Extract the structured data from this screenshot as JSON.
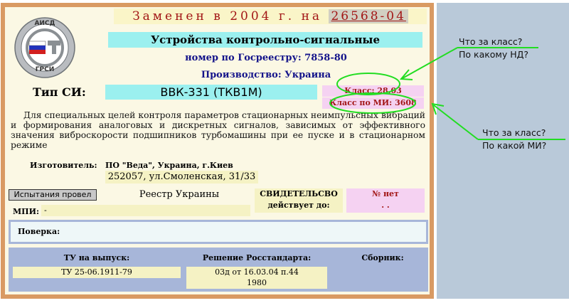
{
  "header": {
    "replaced_prefix": "Заменен в 2004 г. на",
    "replaced_number": "26568-04",
    "title": "Устройства контрольно-сигнальные",
    "registry_number": "номер по Госреестру: 7858-80",
    "production": "Производство: Украина"
  },
  "logo": {
    "top_text": "АИСД",
    "bottom_text": "ГРСИ"
  },
  "instrument": {
    "type_label": "Тип СИ:",
    "type_value": "ВВК-331 (ТКВ1М)",
    "class_nd": "Класс: 28.03",
    "class_mi": "Класс по МИ: 3608"
  },
  "description": "Для специальных целей контроля параметров стационарных неимпульсных вибраций и формирования аналоговых и дискретных сигналов, зависимых от эффективного значения виброскорости подшипников турбомашины при ее пуске и в стационарном режиме",
  "manufacturer": {
    "label": "Изготовитель:",
    "name": "ПО \"Веда\", Украина, г.Киев",
    "address": "252057, ул.Смоленская, 31/33"
  },
  "tests_button": "Испытания провел",
  "registry": "Реестр Украины",
  "certificate": {
    "label_line1": "СВИДЕТЕЛЬСВО",
    "label_line2": "действует до:",
    "number_line": "№ нет",
    "date_line": ". ."
  },
  "mpi": {
    "label": "МПИ:",
    "value": "-"
  },
  "poverka": {
    "label": "Поверка:"
  },
  "bottom": {
    "tu_header": "ТУ на выпуск:",
    "tu_value": "ТУ 25-06.1911-79",
    "decision_header": "Решение Росстандарта:",
    "decision_line1": "03д от 16.03.04 п.44",
    "decision_line2": "1980",
    "collection_header": "Сборник:"
  },
  "annotations": {
    "top_line1": "Что за класс?",
    "top_line2": "По какому НД?",
    "bottom_line1": "Что за класс?",
    "bottom_line2": "По какой МИ?",
    "color": "#22dd22"
  },
  "colors": {
    "frame": "#d99a63",
    "panel": "#fbf8e4",
    "cyan_field": "#9bf0ef",
    "pink_field": "#f5d2f2",
    "dark_red_text": "#a21616",
    "navy_text": "#13138a",
    "side_strip": "#b9c9d9"
  }
}
